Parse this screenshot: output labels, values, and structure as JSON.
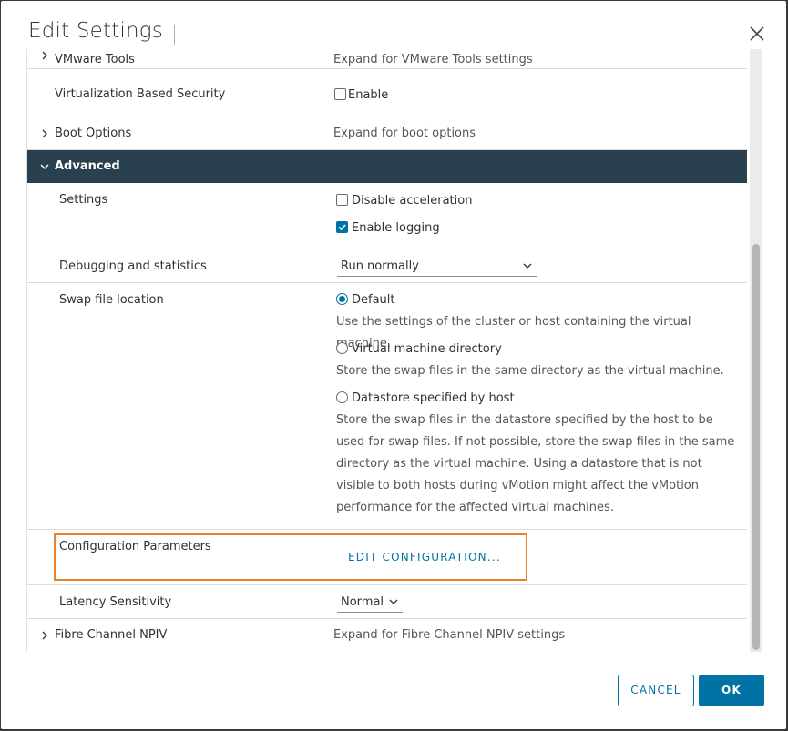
{
  "dialog": {
    "title": "Edit Settings"
  },
  "rows": {
    "vmware_tools": {
      "label": "VMware Tools",
      "desc": "Expand for VMware Tools settings"
    },
    "vbs": {
      "label": "Virtualization Based Security",
      "checkbox_label": "Enable",
      "checked": false
    },
    "boot_options": {
      "label": "Boot Options",
      "desc": "Expand for boot options"
    },
    "advanced": {
      "label": "Advanced"
    },
    "settings": {
      "label": "Settings",
      "disable_acceleration": "Disable acceleration",
      "enable_logging": "Enable logging"
    },
    "debugging": {
      "label": "Debugging and statistics",
      "value": "Run normally"
    },
    "swap": {
      "label": "Swap file location",
      "options": [
        {
          "label": "Default",
          "desc": "Use the settings of the cluster or host containing the virtual machine."
        },
        {
          "label": "Virtual machine directory",
          "desc": "Store the swap files in the same directory as the virtual machine."
        },
        {
          "label": "Datastore specified by host",
          "desc": "Store the swap files in the datastore specified by the host to be used for swap files. If not possible, store the swap files in the same directory as the virtual machine. Using a datastore that is not visible to both hosts during vMotion might affect the vMotion performance for the affected virtual machines."
        }
      ]
    },
    "config_params": {
      "label": "Configuration Parameters",
      "button": "EDIT CONFIGURATION..."
    },
    "latency": {
      "label": "Latency Sensitivity",
      "value": "Normal"
    },
    "fibre_channel": {
      "label": "Fibre Channel NPIV",
      "desc": "Expand for Fibre Channel NPIV settings"
    }
  },
  "footer": {
    "cancel": "CANCEL",
    "ok": "OK"
  },
  "colors": {
    "accent": "#0072a3",
    "header_bg": "#29414e",
    "highlight": "#e8822a"
  }
}
